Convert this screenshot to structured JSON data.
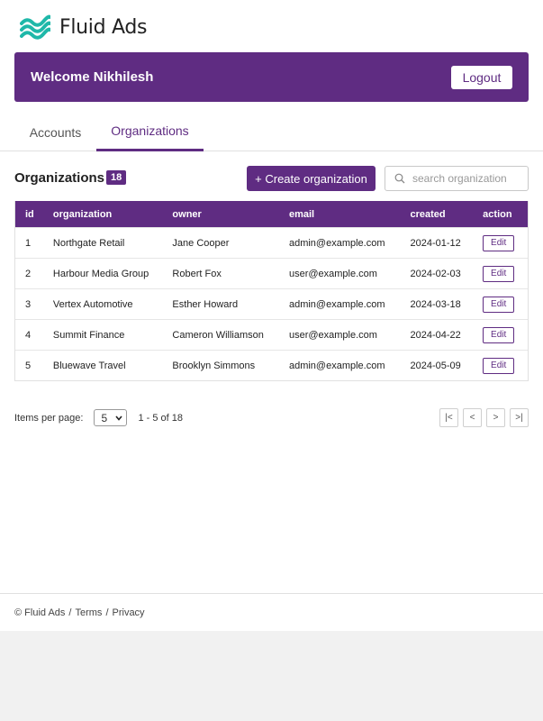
{
  "brand": {
    "name": "Fluid Ads",
    "logo_icon": "wave-logo-icon",
    "logo_color": "#1fb8a9"
  },
  "header": {
    "welcome": "Welcome Nikhilesh",
    "logout_label": "Logout",
    "accent": "#5f2c82"
  },
  "tabs": [
    {
      "label": "Accounts",
      "active": false
    },
    {
      "label": "Organizations",
      "active": true
    }
  ],
  "section": {
    "title": "Organizations",
    "count": "18",
    "create_label": "+ Create organization",
    "search_placeholder": "search organization"
  },
  "table": {
    "columns": [
      "id",
      "organization",
      "owner",
      "email",
      "created",
      "action"
    ],
    "rows": [
      {
        "id": "1",
        "organization": "Northgate Retail",
        "owner": "Jane Cooper",
        "email": "admin@example.com",
        "created": "2024-01-12",
        "action": "Edit"
      },
      {
        "id": "2",
        "organization": "Harbour Media Group",
        "owner": "Robert Fox",
        "email": "user@example.com",
        "created": "2024-02-03",
        "action": "Edit"
      },
      {
        "id": "3",
        "organization": "Vertex Automotive",
        "owner": "Esther Howard",
        "email": "admin@example.com",
        "created": "2024-03-18",
        "action": "Edit"
      },
      {
        "id": "4",
        "organization": "Summit Finance",
        "owner": "Cameron Williamson",
        "email": "user@example.com",
        "created": "2024-04-22",
        "action": "Edit"
      },
      {
        "id": "5",
        "organization": "Bluewave Travel",
        "owner": "Brooklyn Simmons",
        "email": "admin@example.com",
        "created": "2024-05-09",
        "action": "Edit"
      }
    ]
  },
  "pagination": {
    "items_per_page_label": "Items per page:",
    "page_size": "5",
    "range": "1 - 5 of 18",
    "first": "|<",
    "prev": "<",
    "next": ">",
    "last": ">|"
  },
  "footer": {
    "copyright": "© Fluid Ads",
    "terms": "Terms",
    "privacy": "Privacy",
    "separator": "/"
  }
}
